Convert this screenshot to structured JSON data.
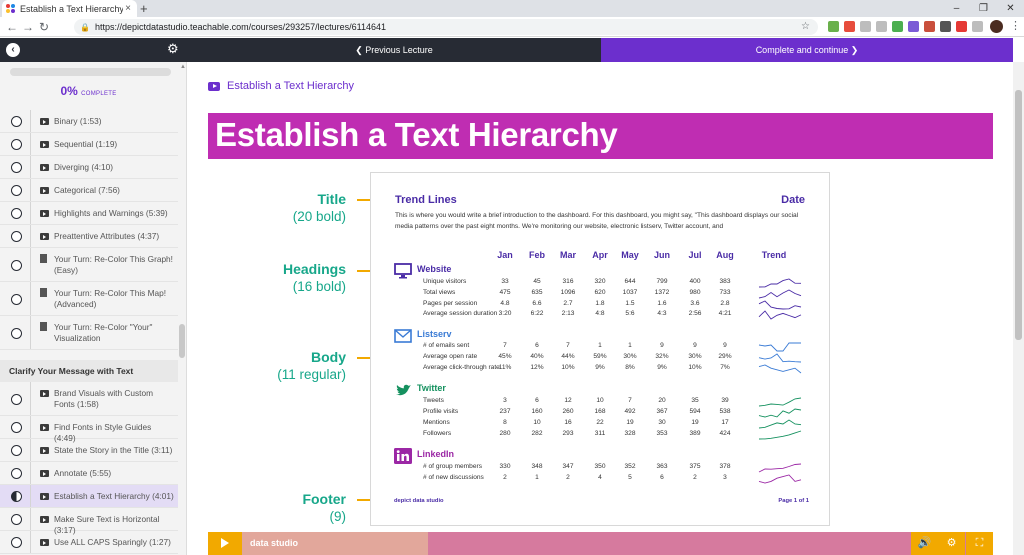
{
  "browser": {
    "tab_title": "Establish a Text Hierarchy | Depi",
    "tab_close": "×",
    "new_tab": "+",
    "url": "https://depictdatastudio.teachable.com/courses/293257/lectures/6114641",
    "back": "←",
    "forward": "→",
    "reload": "↻",
    "win_min": "–",
    "win_max": "❐",
    "win_close": "✕",
    "lock": "🔒",
    "star": "☆",
    "menu": "⋮",
    "extension_colors": [
      "#6ab04c",
      "#e74c3c",
      "#bdbdbd",
      "#bdbdbd",
      "#4caf50",
      "#7b5bd6",
      "#c94f3c",
      "#555555",
      "#e53935",
      "#bdbdbd"
    ]
  },
  "course_nav": {
    "back_icon": "‹",
    "settings_icon": "⚙",
    "previous_label": "❮ Previous Lecture",
    "next_label": "Complete and continue ❯"
  },
  "sidebar": {
    "progress_percent": 0,
    "progress_text": "0%",
    "progress_suffix": "COMPLETE",
    "lessons_a": [
      {
        "label": "Binary (1:53)",
        "type": "video"
      },
      {
        "label": "Sequential (1:19)",
        "type": "video"
      },
      {
        "label": "Diverging (4:10)",
        "type": "video"
      },
      {
        "label": "Categorical (7:56)",
        "type": "video"
      },
      {
        "label": "Highlights and Warnings (5:39)",
        "type": "video"
      },
      {
        "label": "Preattentive Attributes (4:37)",
        "type": "video"
      },
      {
        "label": "Your Turn: Re-Color This Graph! (Easy)",
        "type": "doc"
      },
      {
        "label": "Your Turn: Re-Color This Map! (Advanced)",
        "type": "doc"
      },
      {
        "label": "Your Turn: Re-Color \"Your\" Visualization",
        "type": "doc"
      }
    ],
    "section_title": "Clarify Your Message with Text",
    "lessons_b": [
      {
        "label": "Brand Visuals with Custom Fonts (1:58)",
        "type": "video"
      },
      {
        "label": "Find Fonts in Style Guides (4:49)",
        "type": "video"
      },
      {
        "label": "State the Story in the Title (3:11)",
        "type": "video"
      },
      {
        "label": "Annotate (5:55)",
        "type": "video"
      },
      {
        "label": "Establish a Text Hierarchy (4:01)",
        "type": "video",
        "active": true
      },
      {
        "label": "Make Sure Text is Horizontal (3:17)",
        "type": "video"
      },
      {
        "label": "Use ALL CAPS Sparingly (1:27)",
        "type": "video"
      }
    ]
  },
  "main": {
    "lecture_title": "Establish a Text Hierarchy",
    "banner_title": "Establish a Text Hierarchy",
    "banner_color": "#bf2db2",
    "accent": "#6c2fcd",
    "callouts": [
      {
        "top": "Title",
        "sub": "(20 bold)"
      },
      {
        "top": "Headings",
        "sub": "(16 bold)"
      },
      {
        "top": "Body",
        "sub": "(11 regular)"
      },
      {
        "top": "Footer",
        "sub": "(9)"
      }
    ]
  },
  "dashboard": {
    "title": "Trend Lines",
    "date": "Date",
    "intro": "This is where you would write a brief introduction to the dashboard. For this dashboard, you might say, \"This dashboard displays our social media patterns over the past eight months. We're monitoring our website, electronic listserv, Twitter account, and",
    "months": [
      "Jan",
      "Feb",
      "Mar",
      "Apr",
      "May",
      "Jun",
      "Jul",
      "Aug"
    ],
    "trend_label": "Trend",
    "sections": [
      {
        "name": "Website",
        "icon": "monitor-icon",
        "rows": [
          {
            "label": "Unique visitors",
            "values": [
              "33",
              "45",
              "316",
              "320",
              "644",
              "799",
              "400",
              "383"
            ]
          },
          {
            "label": "Total views",
            "values": [
              "475",
              "635",
              "1096",
              "620",
              "1037",
              "1372",
              "980",
              "733"
            ]
          },
          {
            "label": "Pages per session",
            "values": [
              "4.8",
              "6.6",
              "2.7",
              "1.8",
              "1.5",
              "1.6",
              "3.6",
              "2.8"
            ]
          },
          {
            "label": "Average session duration",
            "values": [
              "3:20",
              "6:22",
              "2:13",
              "4:8",
              "5:6",
              "4:3",
              "2:56",
              "4:21"
            ]
          }
        ]
      },
      {
        "name": "Listserv",
        "icon": "envelope-icon",
        "rows": [
          {
            "label": "# of emails sent",
            "values": [
              "7",
              "6",
              "7",
              "1",
              "1",
              "9",
              "9",
              "9"
            ]
          },
          {
            "label": "Average open rate",
            "values": [
              "45%",
              "40%",
              "44%",
              "59%",
              "30%",
              "32%",
              "30%",
              "29%"
            ]
          },
          {
            "label": "Average click-through rate",
            "values": [
              "11%",
              "12%",
              "10%",
              "9%",
              "8%",
              "9%",
              "10%",
              "7%"
            ]
          }
        ]
      },
      {
        "name": "Twitter",
        "icon": "bird-icon",
        "rows": [
          {
            "label": "Tweets",
            "values": [
              "3",
              "6",
              "12",
              "10",
              "7",
              "20",
              "35",
              "39"
            ]
          },
          {
            "label": "Profile visits",
            "values": [
              "237",
              "160",
              "260",
              "168",
              "492",
              "367",
              "594",
              "538"
            ]
          },
          {
            "label": "Mentions",
            "values": [
              "8",
              "10",
              "16",
              "22",
              "19",
              "30",
              "19",
              "17"
            ]
          },
          {
            "label": "Followers",
            "values": [
              "280",
              "282",
              "293",
              "311",
              "328",
              "353",
              "389",
              "424"
            ]
          }
        ]
      },
      {
        "name": "LinkedIn",
        "icon": "linkedin-icon",
        "rows": [
          {
            "label": "# of group members",
            "values": [
              "330",
              "348",
              "347",
              "350",
              "352",
              "363",
              "375",
              "378"
            ]
          },
          {
            "label": "# of new discussions",
            "values": [
              "2",
              "1",
              "2",
              "4",
              "5",
              "6",
              "2",
              "3"
            ]
          }
        ]
      }
    ],
    "footer_left": "depict data studio",
    "footer_right": "Page 1 of 1"
  },
  "video": {
    "brand_text": "data studio",
    "played_fraction": 0.28,
    "volume_icon": "🔊",
    "settings_icon": "⚙",
    "fullscreen_icon": "⛶"
  }
}
